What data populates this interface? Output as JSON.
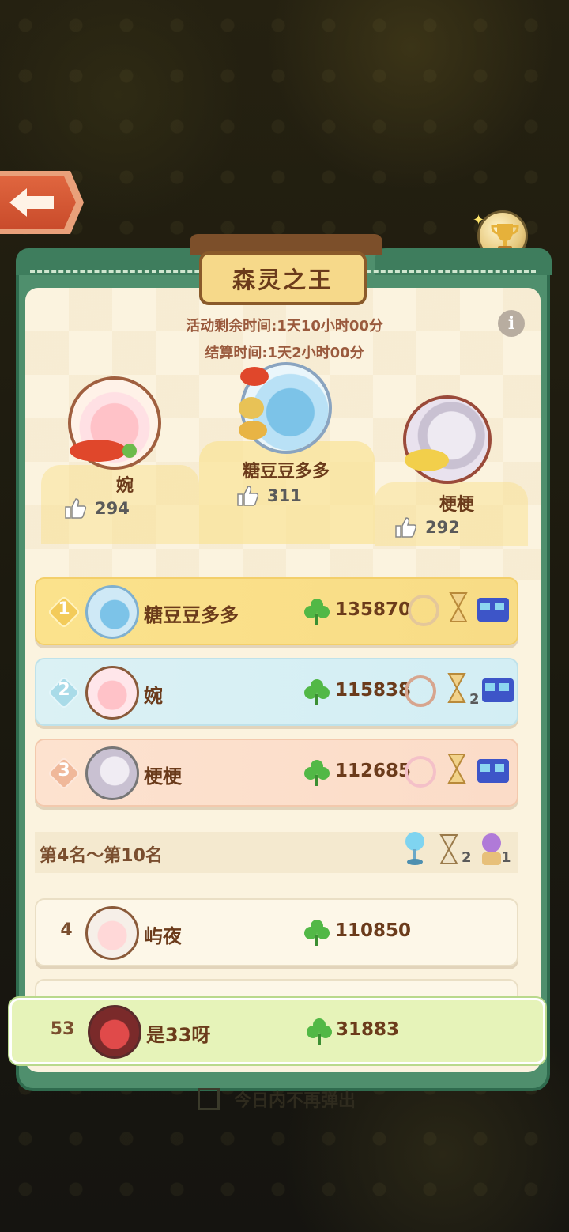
{
  "event": {
    "title": "森灵之王",
    "remaining_time": "活动剩余时间:1天10小时00分",
    "settle_time": "结算时间:1天2小时00分",
    "info_icon": "info-icon"
  },
  "colors": {
    "panel_green": "#4f8f6d",
    "panel_cream": "#fbf3df",
    "gold_row": "#fbe28c",
    "blue_row": "#dbf1f4",
    "pink_row": "#fde2cf",
    "self_row": "#e6f3b9",
    "back_button": "#e0663f"
  },
  "podium": {
    "first": {
      "name": "糖豆豆多多",
      "likes": "311"
    },
    "second": {
      "name": "婉",
      "likes": "294"
    },
    "third": {
      "name": "梗梗",
      "likes": "292"
    }
  },
  "top3": [
    {
      "rank": "1",
      "name": "糖豆豆多多",
      "score": "135870"
    },
    {
      "rank": "2",
      "name": "婉",
      "score": "115838",
      "reward_count": "2"
    },
    {
      "rank": "3",
      "name": "梗梗",
      "score": "112685"
    }
  ],
  "section": {
    "label": "第4名～第10名",
    "reward_counts": [
      "2",
      "1"
    ]
  },
  "rows": [
    {
      "rank": "4",
      "name": "屿夜",
      "score": "110850"
    }
  ],
  "self": {
    "rank": "53",
    "name": "是33呀",
    "score": "31883"
  },
  "bottom_hint": "今日内不再弹出"
}
